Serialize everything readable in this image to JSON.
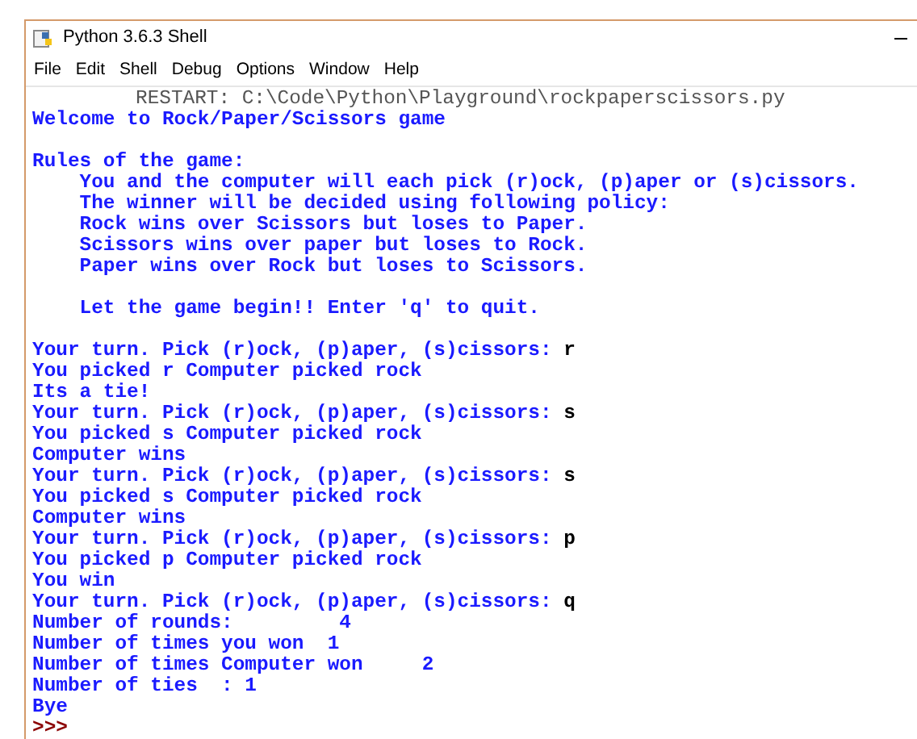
{
  "window": {
    "title": "Python 3.6.3 Shell"
  },
  "menu": [
    "File",
    "Edit",
    "Shell",
    "Debug",
    "Options",
    "Window",
    "Help"
  ],
  "console": [
    {
      "kind": "restart",
      "text": "RESTART: C:\\Code\\Python\\Playground\\rockpaperscissors.py"
    },
    {
      "kind": "output",
      "text": "Welcome to Rock/Paper/Scissors game"
    },
    {
      "kind": "blank"
    },
    {
      "kind": "output",
      "text": "Rules of the game:"
    },
    {
      "kind": "output",
      "text": "    You and the computer will each pick (r)ock, (p)aper or (s)cissors."
    },
    {
      "kind": "output",
      "text": "    The winner will be decided using following policy:"
    },
    {
      "kind": "output",
      "text": "    Rock wins over Scissors but loses to Paper."
    },
    {
      "kind": "output",
      "text": "    Scissors wins over paper but loses to Rock."
    },
    {
      "kind": "output",
      "text": "    Paper wins over Rock but loses to Scissors."
    },
    {
      "kind": "blank"
    },
    {
      "kind": "output",
      "text": "    Let the game begin!! Enter 'q' to quit."
    },
    {
      "kind": "blank"
    },
    {
      "kind": "prompt",
      "text": "Your turn. Pick (r)ock, (p)aper, (s)cissors: ",
      "input": "r"
    },
    {
      "kind": "output",
      "text": "You picked r Computer picked rock"
    },
    {
      "kind": "output",
      "text": "Its a tie!"
    },
    {
      "kind": "prompt",
      "text": "Your turn. Pick (r)ock, (p)aper, (s)cissors: ",
      "input": "s"
    },
    {
      "kind": "output",
      "text": "You picked s Computer picked rock"
    },
    {
      "kind": "output",
      "text": "Computer wins"
    },
    {
      "kind": "prompt",
      "text": "Your turn. Pick (r)ock, (p)aper, (s)cissors: ",
      "input": "s"
    },
    {
      "kind": "output",
      "text": "You picked s Computer picked rock"
    },
    {
      "kind": "output",
      "text": "Computer wins"
    },
    {
      "kind": "prompt",
      "text": "Your turn. Pick (r)ock, (p)aper, (s)cissors: ",
      "input": "p"
    },
    {
      "kind": "output",
      "text": "You picked p Computer picked rock"
    },
    {
      "kind": "output",
      "text": "You win"
    },
    {
      "kind": "prompt",
      "text": "Your turn. Pick (r)ock, (p)aper, (s)cissors: ",
      "input": "q"
    },
    {
      "kind": "output",
      "text": "Number of rounds:         4"
    },
    {
      "kind": "output",
      "text": "Number of times you won  1"
    },
    {
      "kind": "output",
      "text": "Number of times Computer won     2"
    },
    {
      "kind": "output",
      "text": "Number of ties  : 1"
    },
    {
      "kind": "output",
      "text": "Bye"
    },
    {
      "kind": "shell_prompt",
      "text": ">>>"
    }
  ]
}
